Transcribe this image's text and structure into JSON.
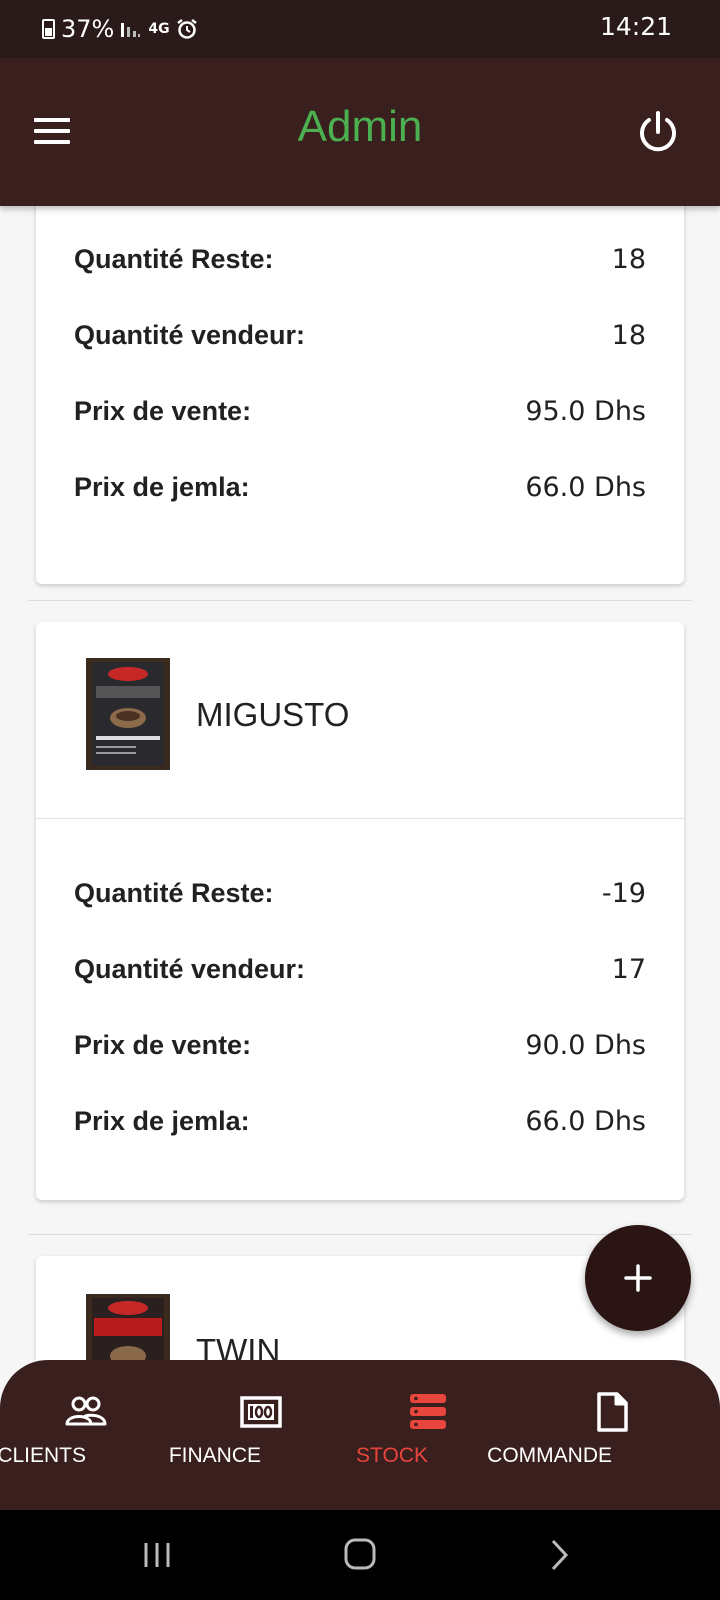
{
  "status_bar": {
    "battery": "37%",
    "network": "4G",
    "time": "14:21"
  },
  "app_bar": {
    "title": "Admin"
  },
  "products": [
    {
      "name": "",
      "rows": [
        {
          "label": "Quantité Reste:",
          "value": "18"
        },
        {
          "label": "Quantité vendeur:",
          "value": "18"
        },
        {
          "label": "Prix de vente:",
          "value": "95.0 Dhs"
        },
        {
          "label": "Prix de jemla:",
          "value": "66.0 Dhs"
        }
      ]
    },
    {
      "name": "MIGUSTO",
      "rows": [
        {
          "label": "Quantité Reste:",
          "value": "-19"
        },
        {
          "label": "Quantité vendeur:",
          "value": "17"
        },
        {
          "label": "Prix de vente:",
          "value": "90.0 Dhs"
        },
        {
          "label": "Prix de jemla:",
          "value": "66.0 Dhs"
        }
      ]
    },
    {
      "name": "TWIN",
      "rows": []
    }
  ],
  "bottom_nav": {
    "items": [
      {
        "label": "CLIENTS",
        "icon": "users-icon"
      },
      {
        "label": "FINANCE",
        "icon": "finance-icon"
      },
      {
        "label": "STOCK",
        "icon": "stock-icon",
        "active": true
      },
      {
        "label": "COMMANDE",
        "icon": "document-icon"
      }
    ]
  },
  "colors": {
    "app_bar": "#3a1f1f",
    "title": "#4caf50",
    "active_nav": "#e8453c",
    "fab": "#2b1414"
  }
}
